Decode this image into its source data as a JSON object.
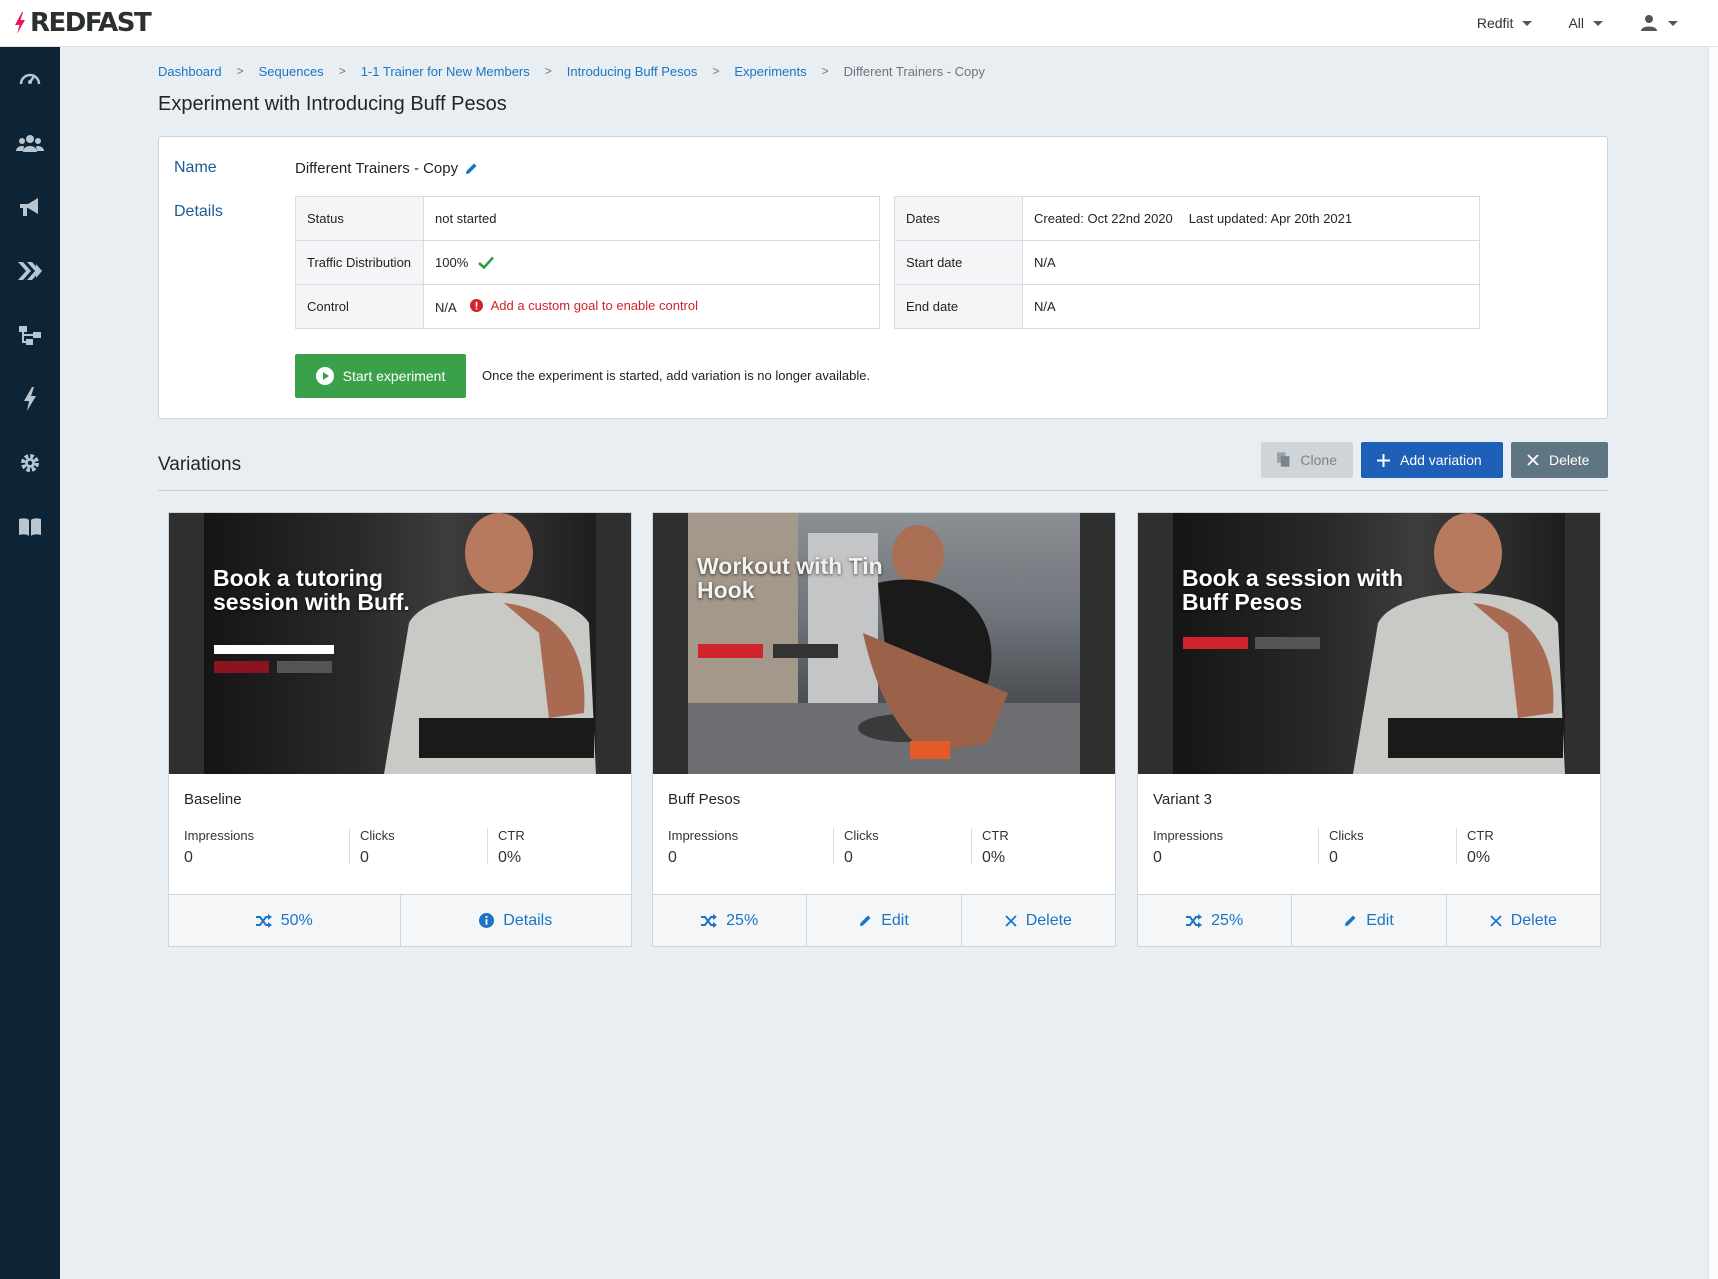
{
  "app": {
    "logo_text": "REDFAST",
    "brand_color": "#e8175d"
  },
  "topbar": {
    "org": "Redfit",
    "filter": "All",
    "user_icon": "user-icon"
  },
  "sidebar": {
    "items": [
      "dashboard-icon",
      "users-icon",
      "megaphone-icon",
      "chevrons-icon",
      "sitemap-icon",
      "bolt-icon",
      "gear-icon",
      "book-icon"
    ]
  },
  "breadcrumbs": [
    "Dashboard",
    "Sequences",
    "1-1 Trainer for New Members",
    "Introducing Buff Pesos",
    "Experiments",
    "Different Trainers - Copy"
  ],
  "page_title": "Experiment with Introducing Buff Pesos",
  "experiment": {
    "name_label": "Name",
    "name_value": "Different Trainers - Copy",
    "details_label": "Details",
    "status_key": "Status",
    "status_value": "not started",
    "traffic_key": "Traffic Distribution",
    "traffic_value": "100%",
    "control_key": "Control",
    "control_value": "N/A",
    "control_error": "Add a custom goal to enable control",
    "dates_key": "Dates",
    "created": "Created: Oct 22nd 2020",
    "updated": "Last updated: Apr 20th 2021",
    "start_key": "Start date",
    "start_value": "N/A",
    "end_key": "End date",
    "end_value": "N/A",
    "start_button": "Start experiment",
    "start_note": "Once the experiment is started, add variation is no longer available."
  },
  "variations": {
    "title": "Variations",
    "clone": "Clone",
    "add": "Add variation",
    "delete": "Delete",
    "cards": [
      {
        "name": "Baseline",
        "hero": "Book a tutoring\nsession with Buff.",
        "impressions_label": "Impressions",
        "impressions": "0",
        "clicks_label": "Clicks",
        "clicks": "0",
        "ctr_label": "CTR",
        "ctr": "0%",
        "split": "50%",
        "action2": "Details"
      },
      {
        "name": "Buff Pesos",
        "hero": "Workout with Tin\nHook",
        "impressions_label": "Impressions",
        "impressions": "0",
        "clicks_label": "Clicks",
        "clicks": "0",
        "ctr_label": "CTR",
        "ctr": "0%",
        "split": "25%",
        "action2": "Edit",
        "action3": "Delete"
      },
      {
        "name": "Variant 3",
        "hero": "Book a session with\nBuff Pesos",
        "impressions_label": "Impressions",
        "impressions": "0",
        "clicks_label": "Clicks",
        "clicks": "0",
        "ctr_label": "CTR",
        "ctr": "0%",
        "split": "25%",
        "action2": "Edit",
        "action3": "Delete"
      }
    ]
  }
}
